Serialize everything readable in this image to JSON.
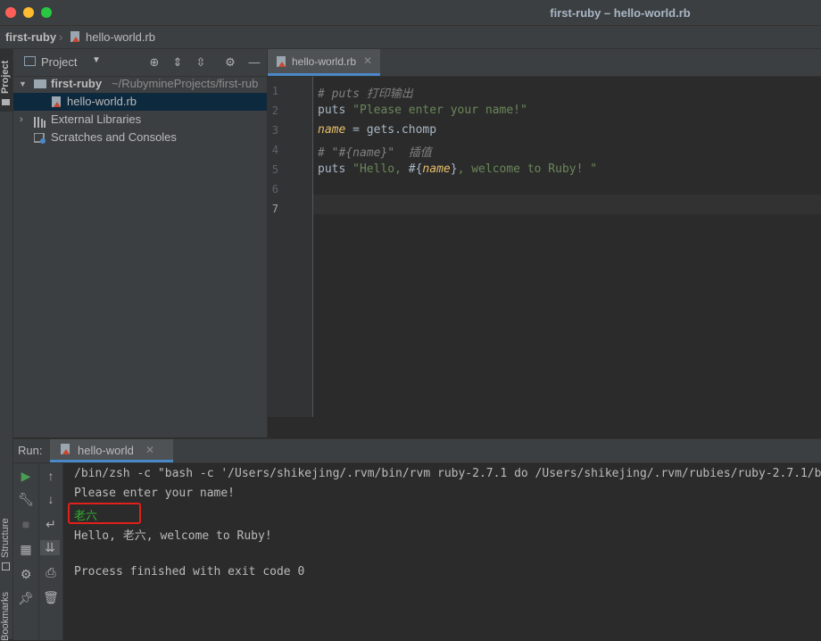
{
  "window": {
    "title": "first-ruby – hello-world.rb"
  },
  "navbar": {
    "project": "first-ruby",
    "file": "hello-world.rb"
  },
  "left_stripe": {
    "project_tab": "Project",
    "structure_tab": "Structure",
    "bookmarks_tab": "Bookmarks"
  },
  "project_panel": {
    "title": "Project",
    "tree": {
      "root_name": "first-ruby",
      "root_path": "~/RubymineProjects/first-rub",
      "file": "hello-world.rb",
      "external": "External Libraries",
      "scratches": "Scratches and Consoles"
    }
  },
  "editor": {
    "tab_label": "hello-world.rb",
    "line_numbers": [
      "1",
      "2",
      "3",
      "4",
      "5",
      "6",
      "7"
    ],
    "lines": {
      "l1_comment": "# puts 打印输出",
      "l2_kw": "puts ",
      "l2_str": "\"Please enter your name!\"",
      "l3_var": "name",
      "l3_rest": " = gets.chomp",
      "l4_comment": "# \"#{name}\"  插值",
      "l5_kw": "puts ",
      "l5_str_a": "\"Hello, ",
      "l5_interp_open": "#{",
      "l5_var": "name",
      "l5_interp_close": "}",
      "l5_str_b": ", welcome to Ruby! \""
    }
  },
  "run_panel": {
    "label": "Run:",
    "tab_label": "hello-world",
    "output": [
      "/bin/zsh -c \"bash -c '/Users/shikejing/.rvm/bin/rvm ruby-2.7.1 do /Users/shikejing/.rvm/rubies/ruby-2.7.1/bi",
      "Please enter your name!",
      "老六",
      "Hello, 老六, welcome to Ruby!",
      "",
      "Process finished with exit code 0"
    ]
  },
  "colors": {
    "user_input": "#2fae2f",
    "highlight_box": "#e0201a",
    "accent": "#4a88c7"
  }
}
